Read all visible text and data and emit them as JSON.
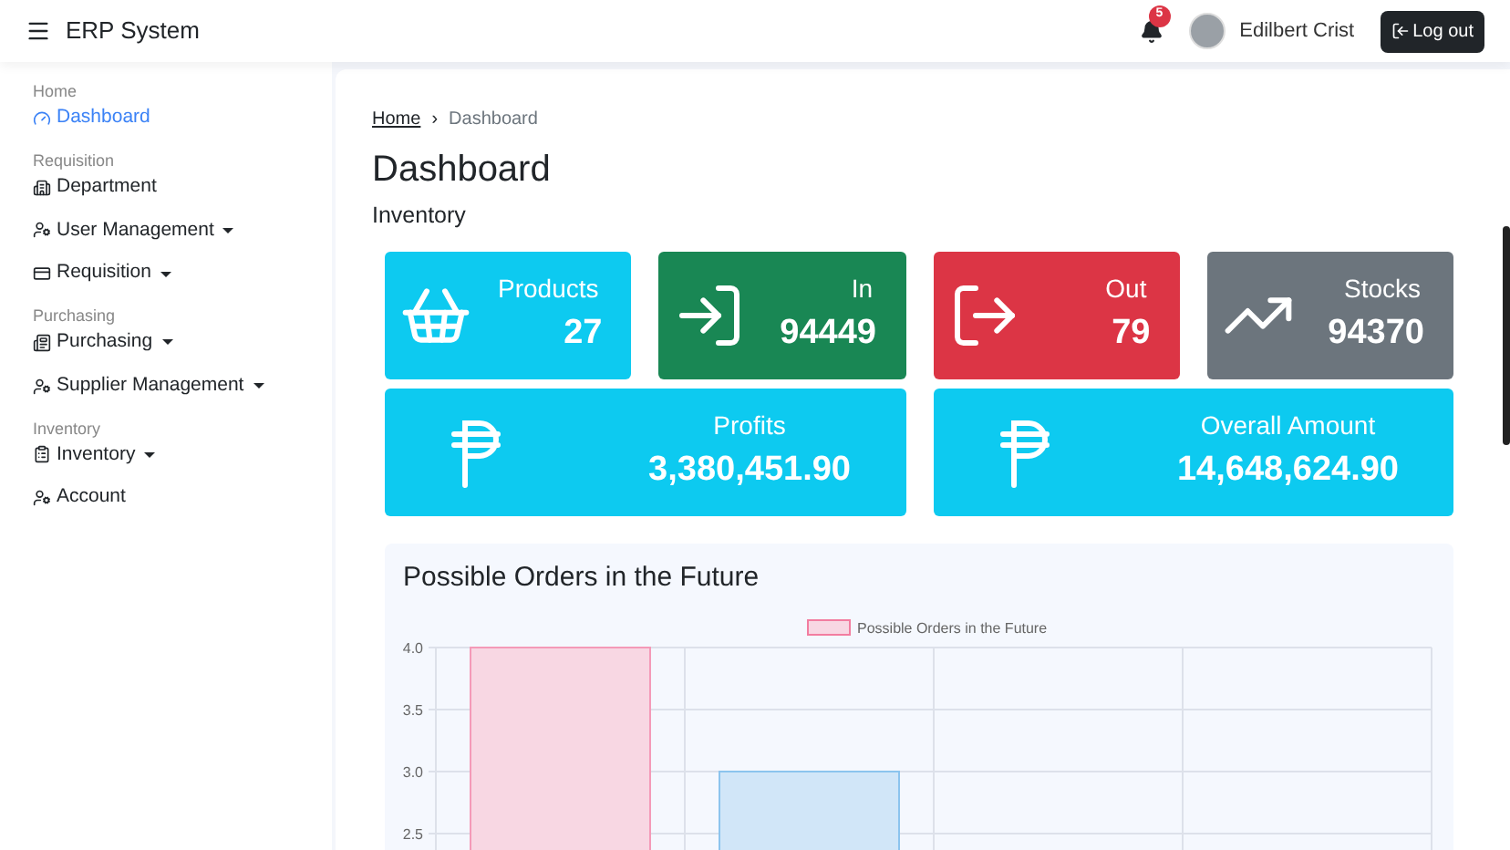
{
  "header": {
    "title": "ERP System",
    "notification_count": "5",
    "user_name": "Edilbert Crist",
    "logout_label": "Log out"
  },
  "sidebar": {
    "sections": [
      {
        "label": "Home",
        "items": [
          {
            "label": "Dashboard",
            "kind": "dashboard",
            "selected": true,
            "expandable": false
          }
        ]
      },
      {
        "label": "Requisition",
        "items": [
          {
            "label": "Department",
            "kind": "department",
            "selected": false,
            "expandable": false
          },
          {
            "label": "User Management",
            "kind": "users",
            "selected": false,
            "expandable": true
          },
          {
            "label": "Requisition",
            "kind": "requisition",
            "selected": false,
            "expandable": true
          }
        ]
      },
      {
        "label": "Purchasing",
        "items": [
          {
            "label": "Purchasing",
            "kind": "purchasing",
            "selected": false,
            "expandable": true
          },
          {
            "label": "Supplier Management",
            "kind": "users",
            "selected": false,
            "expandable": true
          }
        ]
      },
      {
        "label": "Inventory",
        "items": [
          {
            "label": "Inventory",
            "kind": "inventory",
            "selected": false,
            "expandable": true
          },
          {
            "label": "Account",
            "kind": "users",
            "selected": false,
            "expandable": false
          }
        ]
      }
    ]
  },
  "breadcrumb": {
    "separator": "›",
    "items": [
      {
        "label": "Home",
        "link": true
      },
      {
        "label": "Dashboard",
        "link": false
      }
    ]
  },
  "page_title": "Dashboard",
  "section_title": "Inventory",
  "stat_cards": [
    {
      "kind": "basket",
      "label": "Products",
      "value": "27",
      "color": "#0dcaf0"
    },
    {
      "kind": "in",
      "label": "In",
      "value": "94449",
      "color": "#198754"
    },
    {
      "kind": "out",
      "label": "Out",
      "value": "79",
      "color": "#dc3545"
    },
    {
      "kind": "chart",
      "label": "Stocks",
      "value": "94370",
      "color": "#6c757d"
    }
  ],
  "money_cards": [
    {
      "label": "Profits",
      "value": "3,380,451.90",
      "color": "#0dcaf0"
    },
    {
      "label": "Overall Amount",
      "value": "14,648,624.90",
      "color": "#0dcaf0"
    }
  ],
  "chart_panel": {
    "title": "Possible Orders in the Future",
    "chart_data": {
      "type": "bar",
      "grid": true,
      "stacked": true,
      "series": [
        {
          "name": "Possible Orders in the Future",
          "color": "#f8d7e3",
          "values": [
            4,
            null,
            null,
            null
          ]
        },
        {
          "color": "#d1e6f8",
          "values": [
            null,
            3,
            null,
            null
          ]
        }
      ],
      "ylim": [
        2.25,
        4
      ],
      "yticks": [
        {
          "value": 2.5,
          "label": "2.5"
        },
        {
          "value": 3,
          "label": "3.0"
        },
        {
          "value": 3.5,
          "label": "3.5"
        },
        {
          "value": 4,
          "label": "4.0"
        }
      ]
    }
  }
}
